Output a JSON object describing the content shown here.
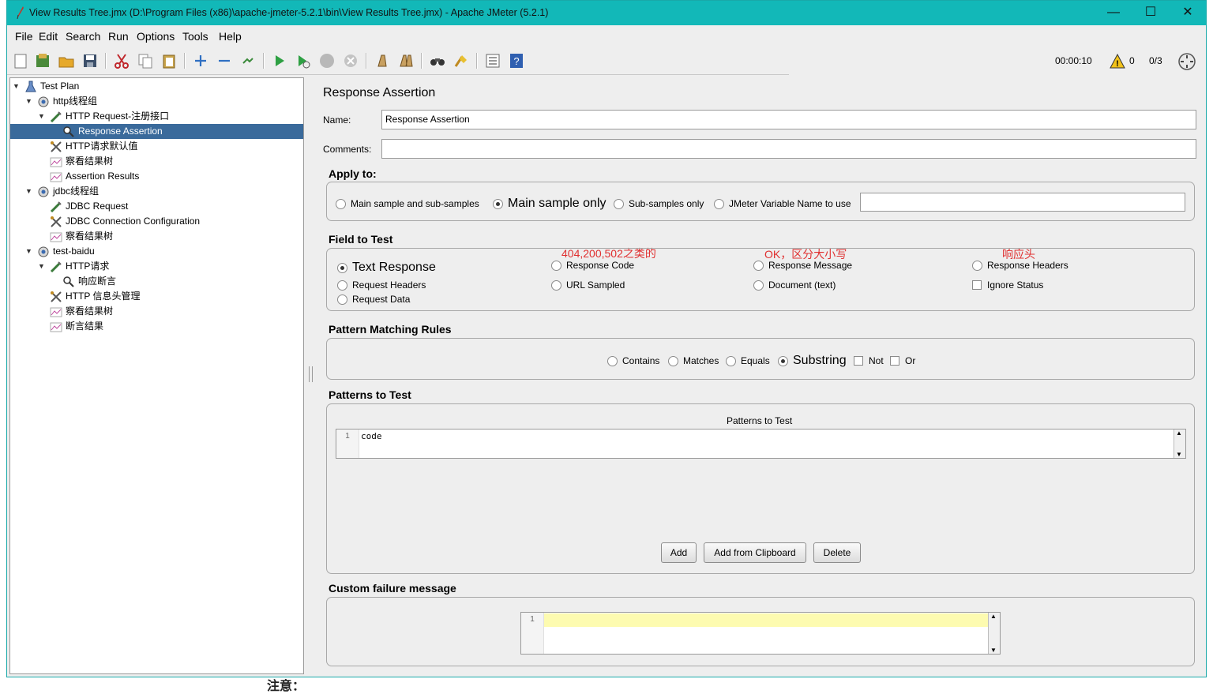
{
  "window": {
    "title": "View Results Tree.jmx (D:\\Program Files (x86)\\apache-jmeter-5.2.1\\bin\\View Results Tree.jmx) - Apache JMeter (5.2.1)",
    "minimize": "—",
    "maximize": "☐",
    "close": "✕"
  },
  "menu": [
    "File",
    "Edit",
    "Search",
    "Run",
    "Options",
    "Tools",
    "Help"
  ],
  "status": {
    "elapsed": "00:00:10",
    "warnings": "0",
    "threads": "0/3"
  },
  "tree": [
    {
      "label": "Test Plan",
      "icon": "test-plan-icon"
    },
    {
      "label": "http线程组",
      "icon": "thread-group-icon"
    },
    {
      "label": "HTTP Request-注册接口",
      "icon": "sampler-icon"
    },
    {
      "label": "Response Assertion",
      "icon": "assertion-icon",
      "selected": true
    },
    {
      "label": "HTTP请求默认值",
      "icon": "config-icon"
    },
    {
      "label": "察看结果树",
      "icon": "listener-icon"
    },
    {
      "label": "Assertion Results",
      "icon": "listener-icon"
    },
    {
      "label": "jdbc线程组",
      "icon": "thread-group-icon"
    },
    {
      "label": "JDBC Request",
      "icon": "sampler-icon"
    },
    {
      "label": "JDBC Connection Configuration",
      "icon": "config-icon"
    },
    {
      "label": "察看结果树",
      "icon": "listener-icon"
    },
    {
      "label": "test-baidu",
      "icon": "thread-group-icon"
    },
    {
      "label": "HTTP请求",
      "icon": "sampler-icon"
    },
    {
      "label": "响应断言",
      "icon": "assertion-icon"
    },
    {
      "label": "HTTP 信息头管理",
      "icon": "config-icon"
    },
    {
      "label": "察看结果树",
      "icon": "listener-icon"
    },
    {
      "label": "断言结果",
      "icon": "listener-icon"
    }
  ],
  "panel": {
    "title": "Response Assertion",
    "name_label": "Name:",
    "name_value": "Response Assertion",
    "comments_label": "Comments:",
    "comments_value": ""
  },
  "apply_to": {
    "title": "Apply to:",
    "options": [
      "Main sample and sub-samples",
      "Main sample only",
      "Sub-samples only",
      "JMeter Variable Name to use"
    ],
    "selected": "Main sample only",
    "variable_value": ""
  },
  "field_to_test": {
    "title": "Field to Test",
    "options": [
      "Text Response",
      "Response Code",
      "Response Message",
      "Response Headers",
      "Request Headers",
      "URL Sampled",
      "Document (text)",
      "Request Data"
    ],
    "selected": "Text Response",
    "ignore_status_label": "Ignore Status",
    "ignore_status_checked": false,
    "annotations": [
      "404,200,502之类的",
      "OK，区分大小写",
      "响应头"
    ]
  },
  "pattern_matching": {
    "title": "Pattern Matching Rules",
    "options": [
      "Contains",
      "Matches",
      "Equals",
      "Substring"
    ],
    "selected": "Substring",
    "not_label": "Not",
    "or_label": "Or",
    "not_checked": false,
    "or_checked": false
  },
  "patterns": {
    "title": "Patterns to Test",
    "table_header": "Patterns to Test",
    "lines": [
      "code"
    ],
    "line_no": "1",
    "buttons": [
      "Add",
      "Add from Clipboard",
      "Delete"
    ]
  },
  "custom_failure": {
    "title": "Custom failure message",
    "line_no": "1",
    "value": ""
  },
  "footer_cut_text": "注意："
}
